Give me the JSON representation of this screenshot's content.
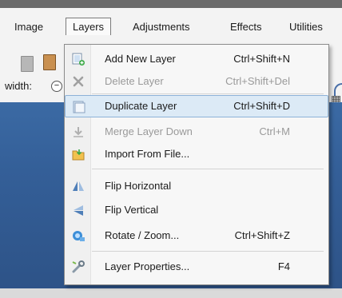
{
  "menubar": {
    "items": [
      {
        "label": "Image"
      },
      {
        "label": "Layers"
      },
      {
        "label": "Adjustments"
      },
      {
        "label": "Effects"
      },
      {
        "label": "Utilities"
      }
    ]
  },
  "toolbar": {
    "width_label": "width:",
    "minus_symbol": "−"
  },
  "layers_menu": {
    "items": [
      {
        "label": "Add New Layer",
        "shortcut": "Ctrl+Shift+N",
        "icon": "add-layer-icon",
        "enabled": true
      },
      {
        "label": "Delete Layer",
        "shortcut": "Ctrl+Shift+Del",
        "icon": "delete-layer-icon",
        "enabled": false
      },
      {
        "label": "Duplicate Layer",
        "shortcut": "Ctrl+Shift+D",
        "icon": "duplicate-layer-icon",
        "enabled": true,
        "highlighted": true
      },
      {
        "label": "Merge Layer Down",
        "shortcut": "Ctrl+M",
        "icon": "merge-layer-down-icon",
        "enabled": false
      },
      {
        "label": "Import From File...",
        "shortcut": "",
        "icon": "import-from-file-icon",
        "enabled": true
      },
      {
        "label": "Flip Horizontal",
        "shortcut": "",
        "icon": "flip-horizontal-icon",
        "enabled": true
      },
      {
        "label": "Flip Vertical",
        "shortcut": "",
        "icon": "flip-vertical-icon",
        "enabled": true
      },
      {
        "label": "Rotate / Zoom...",
        "shortcut": "Ctrl+Shift+Z",
        "icon": "rotate-zoom-icon",
        "enabled": true
      },
      {
        "label": "Layer Properties...",
        "shortcut": "F4",
        "icon": "layer-properties-icon",
        "enabled": true
      }
    ]
  },
  "colors": {
    "menubar_bg": "#f3f3f3",
    "canvas_bg": "#345f98",
    "highlight_bg": "#dceaf6",
    "highlight_border": "#8db2d8",
    "disabled_text": "#9a9a9a"
  }
}
